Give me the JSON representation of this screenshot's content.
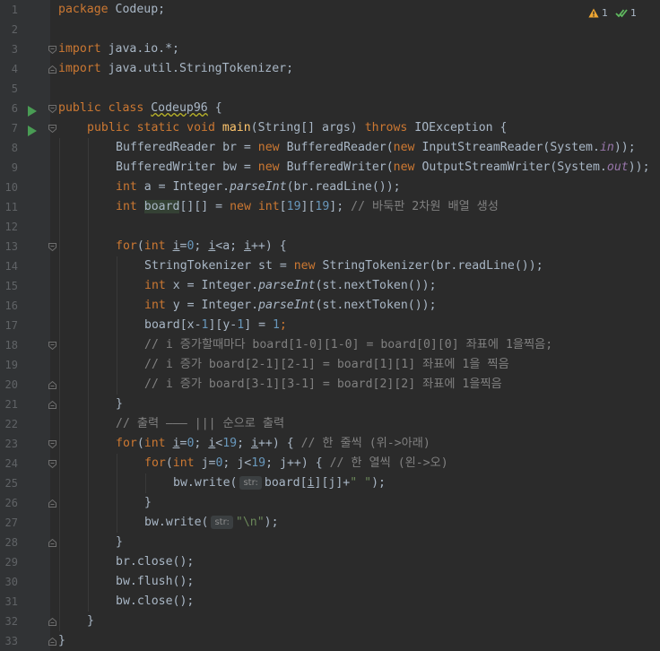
{
  "inspections": {
    "warning_icon": "warning-triangle-icon",
    "warning_count": "1",
    "typo_icon": "double-check-icon",
    "typo_count": "1"
  },
  "editor": {
    "line_numbers": [
      "1",
      "2",
      "3",
      "4",
      "5",
      "6",
      "7",
      "8",
      "9",
      "10",
      "11",
      "12",
      "13",
      "14",
      "15",
      "16",
      "17",
      "18",
      "19",
      "20",
      "21",
      "22",
      "23",
      "24",
      "25",
      "26",
      "27",
      "28",
      "29",
      "30",
      "31",
      "32",
      "33"
    ],
    "hints": {
      "str_label": "str:"
    }
  },
  "code": {
    "l1": [
      "package",
      "Codeup;"
    ],
    "l3": [
      "import",
      "java.io.*;"
    ],
    "l4": [
      "import",
      "java.util.StringTokenizer;"
    ],
    "l6": [
      "public class",
      "Codeup96",
      " {"
    ],
    "l7": [
      "public static void",
      "main",
      "(String[] args)",
      "throws",
      "IOException {"
    ],
    "l8": [
      "BufferedReader br = ",
      "new",
      " BufferedReader(",
      "new",
      " InputStreamReader(System.",
      "in",
      "));"
    ],
    "l9": [
      "BufferedWriter bw = ",
      "new",
      " BufferedWriter(",
      "new",
      " OutputStreamWriter(System.",
      "out",
      "));"
    ],
    "l10": [
      "int",
      " a = Integer.",
      "parseInt",
      "(br.readLine());"
    ],
    "l11": [
      "int",
      "board",
      "[][] = ",
      "new",
      "int",
      "[",
      "19",
      "][",
      "19",
      "];",
      "// 바둑판 2차원 배열 생성"
    ],
    "l13": [
      "for",
      "(",
      "int",
      "i",
      "=",
      "0",
      "; ",
      "i",
      "<a; ",
      "i",
      "++) {"
    ],
    "l14": [
      "StringTokenizer st = ",
      "new",
      " StringTokenizer(br.readLine());"
    ],
    "l15": [
      "int",
      " x = Integer.",
      "parseInt",
      "(st.nextToken());"
    ],
    "l16": [
      "int",
      " y = Integer.",
      "parseInt",
      "(st.nextToken());"
    ],
    "l17": [
      "board[x-",
      "1",
      "][y-",
      "1",
      "] = ",
      "1",
      ";"
    ],
    "l18": "// i 증가할때마다 board[1-0][1-0] = board[0][0] 좌표에 1을찍음;",
    "l19": "// i 증가 board[2-1][2-1] = board[1][1] 좌표에 1을 찍음",
    "l20": "// i 증가 board[3-1][3-1] = board[2][2] 좌표에 1을찍음",
    "l21": "}",
    "l22": "// 출력 ——— ||| 순으로 출력",
    "l23": [
      "for",
      "(",
      "int",
      "i",
      "=",
      "0",
      "; ",
      "i",
      "<",
      "19",
      "; ",
      "i",
      "++) { ",
      "// 한 줄씩 (위->아래)"
    ],
    "l24": [
      "for",
      "(",
      "int",
      "j",
      "=",
      "0",
      "; ",
      "j",
      "<",
      "19",
      "; ",
      "j",
      "++) { ",
      "// 한 열씩 (왼->오)"
    ],
    "l25": [
      "bw.write(",
      "board[",
      "i",
      "][",
      "j",
      "]+",
      "\" \"",
      ");"
    ],
    "l26": "}",
    "l27": [
      "bw.write(",
      "\"\\n\"",
      ");"
    ],
    "l28": "}",
    "l29": "br.close();",
    "l30": "bw.flush();",
    "l31": "bw.close();",
    "l32": "}",
    "l33": "}"
  }
}
